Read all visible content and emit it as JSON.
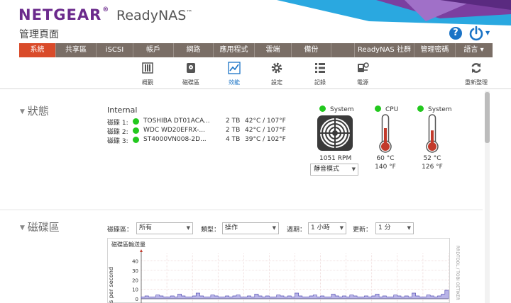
{
  "brand": {
    "logo": "NETGEAR",
    "product": "ReadyNAS",
    "product_mark": "™"
  },
  "page_title": "管理頁面",
  "nav": [
    {
      "label": "系統",
      "active": true
    },
    {
      "label": "共享區"
    },
    {
      "label": "iSCSI"
    },
    {
      "label": "帳戶"
    },
    {
      "label": "網路"
    },
    {
      "label": "應用程式"
    },
    {
      "label": "雲端"
    },
    {
      "label": "備份"
    },
    {
      "label": ""
    },
    {
      "label": "ReadyNAS 社群"
    },
    {
      "label": "管理密碼"
    },
    {
      "label": "語言 ▾"
    }
  ],
  "subnav": [
    {
      "label": "概觀",
      "icon": "overview-icon"
    },
    {
      "label": "磁碟區",
      "icon": "volume-icon"
    },
    {
      "label": "效能",
      "icon": "performance-icon",
      "active": true
    },
    {
      "label": "設定",
      "icon": "settings-gear-icon"
    },
    {
      "label": "記錄",
      "icon": "logs-list-icon"
    },
    {
      "label": "電源",
      "icon": "power-plug-icon"
    },
    {
      "label": "重新整理",
      "icon": "refresh-icon"
    }
  ],
  "status": {
    "heading": "狀態",
    "internal_label": "Internal",
    "disks": [
      {
        "label": "磁碟 1:",
        "model": "TOSHIBA DT01ACA...",
        "size": "2 TB",
        "temp": "42°C / 107°F"
      },
      {
        "label": "磁碟 2:",
        "model": "WDC WD20EFRX-...",
        "size": "2 TB",
        "temp": "42°C / 107°F"
      },
      {
        "label": "磁碟 3:",
        "model": "ST4000VN008-2D...",
        "size": "4 TB",
        "temp": "39°C / 102°F"
      }
    ],
    "fan": {
      "label": "System",
      "rpm": "1051 RPM",
      "mode": "靜音模式"
    },
    "cpu": {
      "label": "CPU",
      "temp_c": "60 °C",
      "temp_f": "140 °F",
      "level": 0.6
    },
    "system": {
      "label": "System",
      "temp_c": "52 °C",
      "temp_f": "126 °F",
      "level": 0.52
    },
    "status_color": "#22c81e"
  },
  "volume": {
    "heading": "磁碟區",
    "filters": {
      "volume_label": "磁碟區：",
      "volume_value": "所有",
      "type_label": "類型：",
      "type_value": "操作",
      "period_label": "週期：",
      "period_value": "1 小時",
      "update_label": "更新：",
      "update_value": "1 分"
    },
    "chart_title": "磁碟區輸送量",
    "side_text": "RRDTOOL / TOBI OETIKER"
  },
  "chart_data": {
    "type": "area",
    "title": "磁碟區輸送量",
    "ylabel": "s per second",
    "yticks": [
      40,
      30,
      20,
      10,
      0
    ],
    "ylim": [
      0,
      45
    ],
    "values": [
      2,
      3,
      2,
      2,
      4,
      3,
      2,
      2,
      3,
      2,
      5,
      3,
      2,
      2,
      3,
      6,
      3,
      2,
      2,
      4,
      3,
      2,
      2,
      3,
      2,
      3,
      4,
      2,
      2,
      3,
      2,
      5,
      3,
      2,
      3,
      2,
      2,
      4,
      3,
      2,
      3,
      2,
      6,
      3,
      2,
      2,
      3,
      4,
      2,
      3,
      2,
      2,
      5,
      3,
      2,
      3,
      2,
      4,
      3,
      2,
      2,
      3,
      2,
      3,
      5,
      2,
      3,
      2,
      2,
      4,
      3,
      2,
      3,
      2,
      6,
      3,
      2,
      2,
      4,
      3,
      2,
      3,
      5,
      9
    ]
  },
  "colors": {
    "accent": "#d94b2a",
    "nav_bg": "#7a6e66",
    "brand": "#6b2a8c",
    "link": "#1a73c6"
  }
}
